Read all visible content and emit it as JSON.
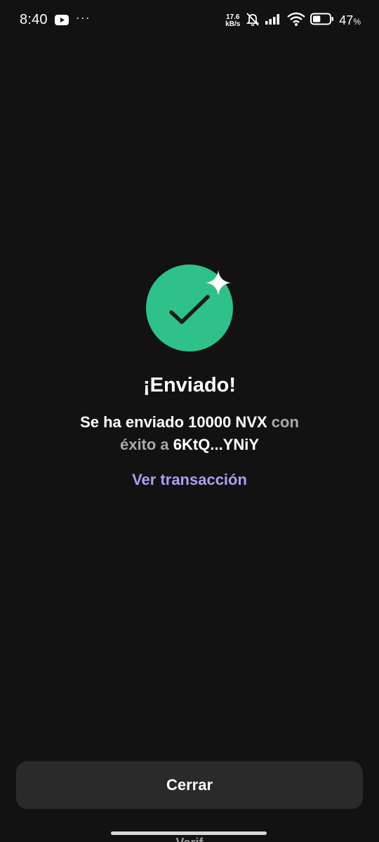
{
  "status_bar": {
    "time": "8:40",
    "overflow_indicator": "···",
    "net_speed_value": "17.6",
    "net_speed_unit": "kB/s",
    "battery_percent": "47",
    "battery_percent_sign": "%",
    "battery_level": 0.47,
    "icons": [
      "youtube-icon",
      "mute-notifications-icon",
      "signal-icon",
      "wifi-icon",
      "battery-icon"
    ]
  },
  "success": {
    "badge_color": "#2fc18a",
    "icons": [
      "check-icon",
      "sparkle-icon"
    ],
    "title": "¡Enviado!",
    "message_part1": "Se ha enviado 10000 NVX",
    "message_part2": " con",
    "message_part3": "éxito a",
    "message_part4": " 6KtQ...YNiY",
    "view_transaction_label": "Ver transacción",
    "link_color": "#ab9ff2"
  },
  "footer": {
    "close_label": "Cerrar",
    "peek_text": "Verif"
  }
}
